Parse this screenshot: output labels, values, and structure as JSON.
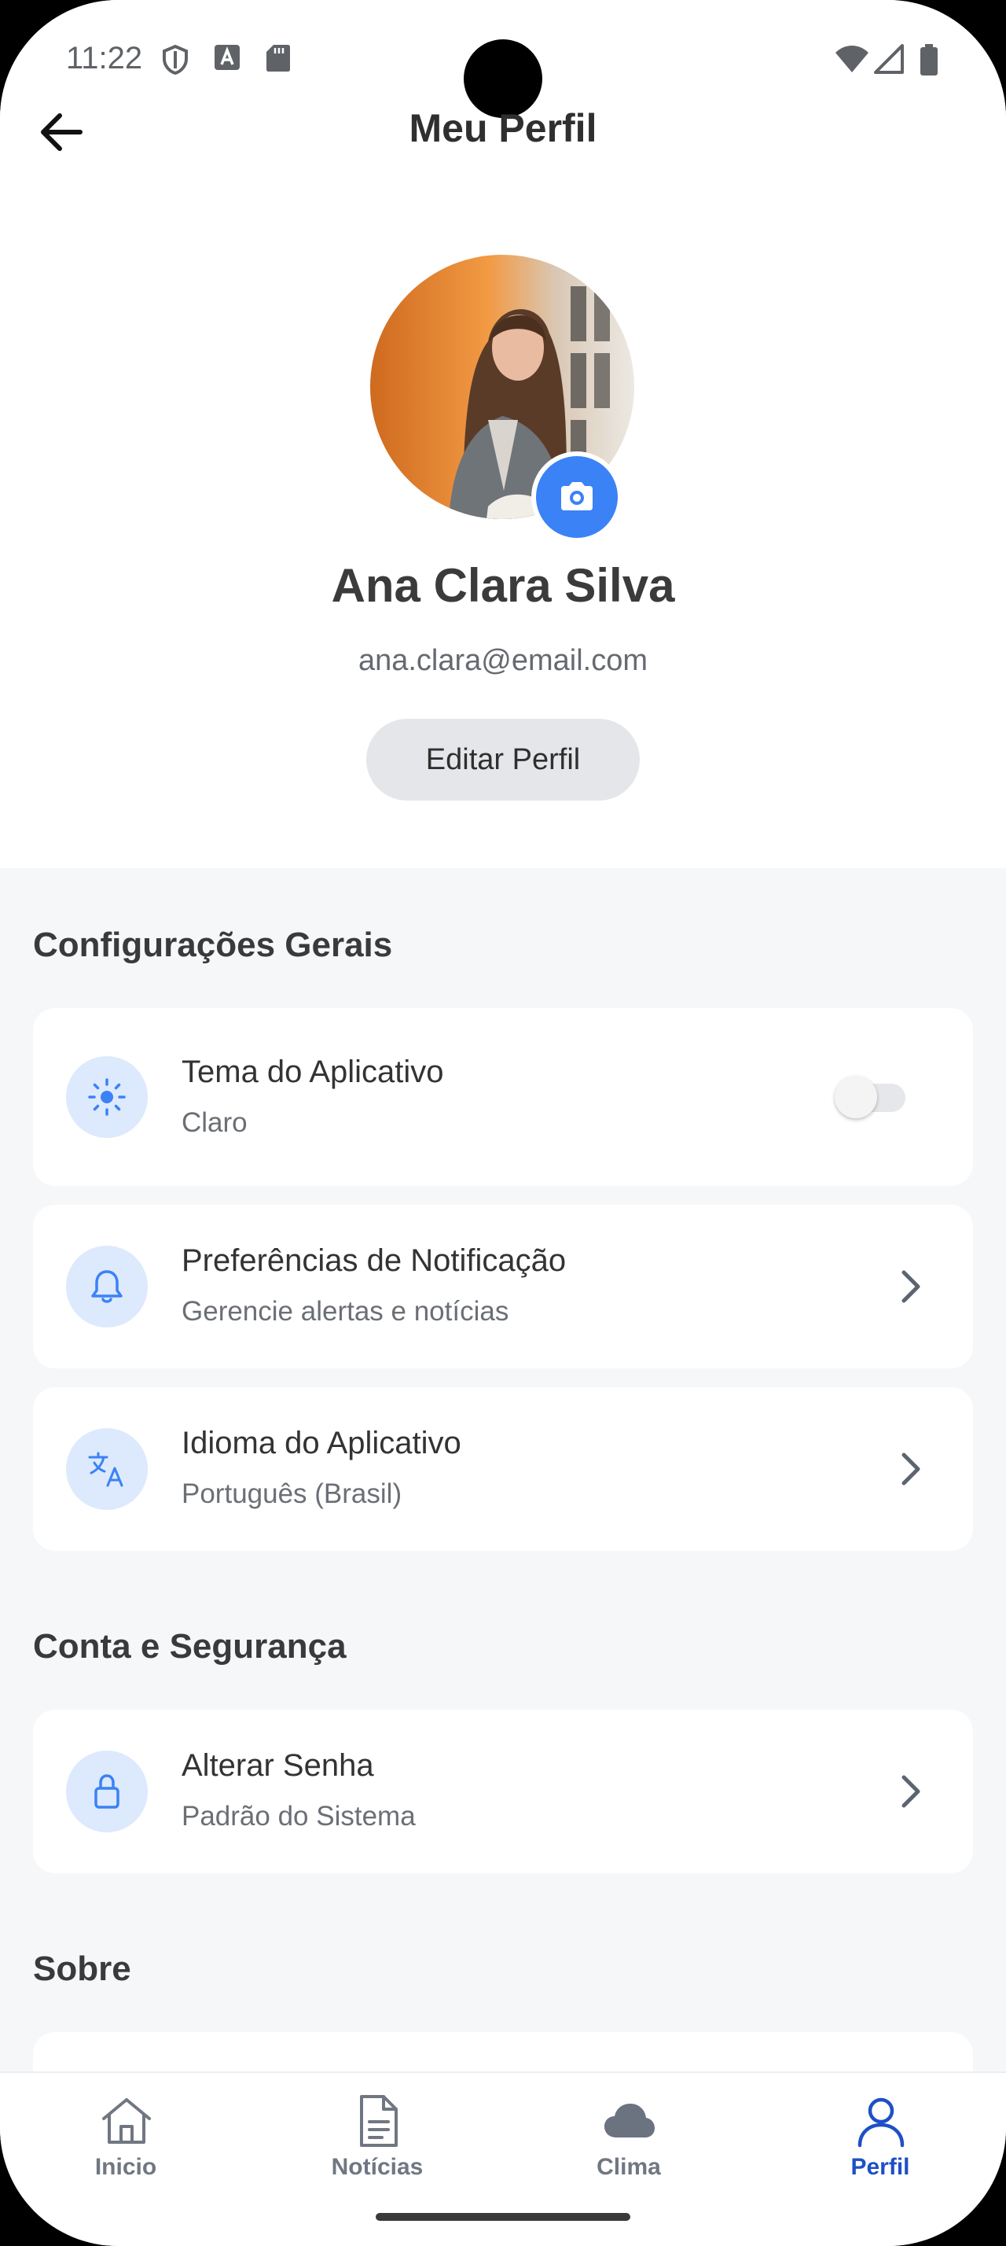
{
  "status_bar": {
    "time": "11:22"
  },
  "header": {
    "title": "Meu Perfil"
  },
  "profile": {
    "name": "Ana Clara Silva",
    "email": "ana.clara@email.com",
    "edit_label": "Editar Perfil"
  },
  "sections": [
    {
      "title": "Configurações Gerais",
      "items": [
        {
          "title": "Tema do Aplicativo",
          "subtitle": "Claro",
          "icon": "sun-icon",
          "control": "toggle",
          "toggle_on": false
        },
        {
          "title": "Preferências de Notificação",
          "subtitle": "Gerencie alertas e notícias",
          "icon": "bell-icon",
          "control": "chevron"
        },
        {
          "title": "Idioma do Aplicativo",
          "subtitle": "Português (Brasil)",
          "icon": "translate-icon",
          "control": "chevron"
        }
      ]
    },
    {
      "title": "Conta e Segurança",
      "items": [
        {
          "title": "Alterar Senha",
          "subtitle": "Padrão do Sistema",
          "icon": "lock-icon",
          "control": "chevron"
        }
      ]
    },
    {
      "title": "Sobre",
      "items": []
    }
  ],
  "bottom_nav": [
    {
      "label": "Inicio",
      "icon": "home-icon",
      "active": false
    },
    {
      "label": "Notícias",
      "icon": "document-icon",
      "active": false
    },
    {
      "label": "Clima",
      "icon": "cloud-icon",
      "active": false
    },
    {
      "label": "Perfil",
      "icon": "person-icon",
      "active": true
    }
  ],
  "colors": {
    "accent": "#3b82f6",
    "nav_active": "#1e4fc6",
    "icon_bg": "#dde9fc",
    "page_bg": "#f6f7f9"
  }
}
